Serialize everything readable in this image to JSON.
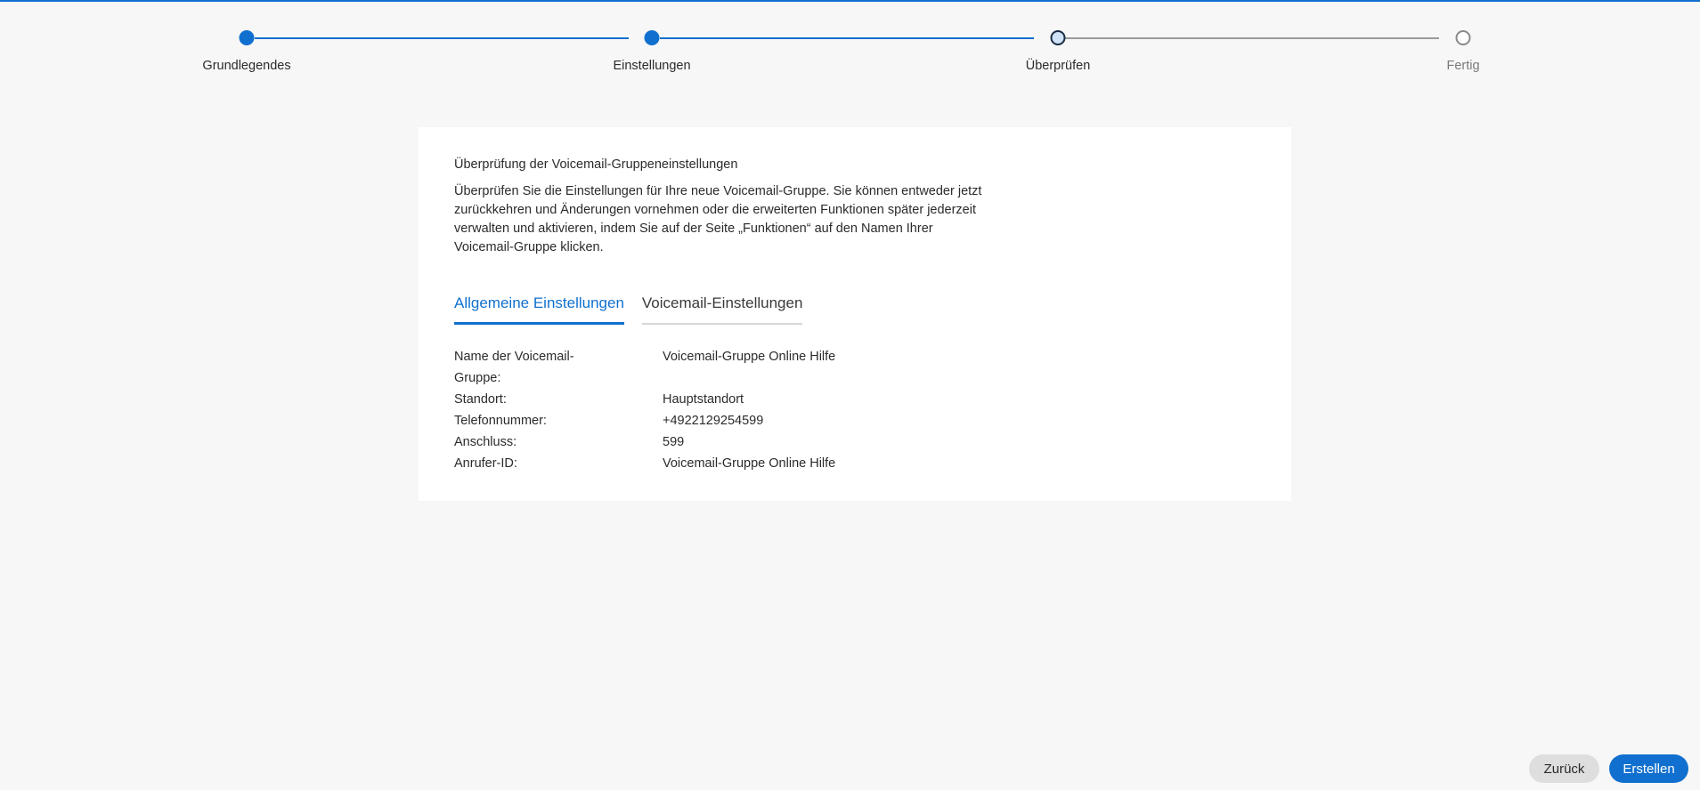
{
  "stepper": {
    "steps": [
      {
        "label": "Grundlegendes",
        "state": "done"
      },
      {
        "label": "Einstellungen",
        "state": "done"
      },
      {
        "label": "Überprüfen",
        "state": "current"
      },
      {
        "label": "Fertig",
        "state": "todo"
      }
    ]
  },
  "card": {
    "title": "Überprüfung der Voicemail-Gruppeneinstellungen",
    "description": "Überprüfen Sie die Einstellungen für Ihre neue Voicemail-Gruppe. Sie können entweder jetzt zurückkehren und Änderungen vornehmen oder die erweiterten Funktionen später jederzeit verwalten und aktivieren, indem Sie auf der Seite „Funktionen“ auf den Namen Ihrer Voicemail-Gruppe klicken.",
    "tabs": [
      {
        "label": "Allgemeine Einstellungen",
        "active": true
      },
      {
        "label": "Voicemail-Einstellungen",
        "active": false
      }
    ],
    "details": [
      {
        "label": "Name der Voicemail-Gruppe:",
        "value": "Voicemail-Gruppe Online Hilfe"
      },
      {
        "label": "Standort:",
        "value": "Hauptstandort"
      },
      {
        "label": "Telefonnummer:",
        "value": "+4922129254599"
      },
      {
        "label": "Anschluss:",
        "value": "599"
      },
      {
        "label": "Anrufer-ID:",
        "value": "Voicemail-Gruppe Online Hilfe"
      }
    ]
  },
  "footer": {
    "back_label": "Zurück",
    "create_label": "Erstellen"
  },
  "colors": {
    "accent": "#1170cf",
    "background": "#f7f7f7"
  }
}
